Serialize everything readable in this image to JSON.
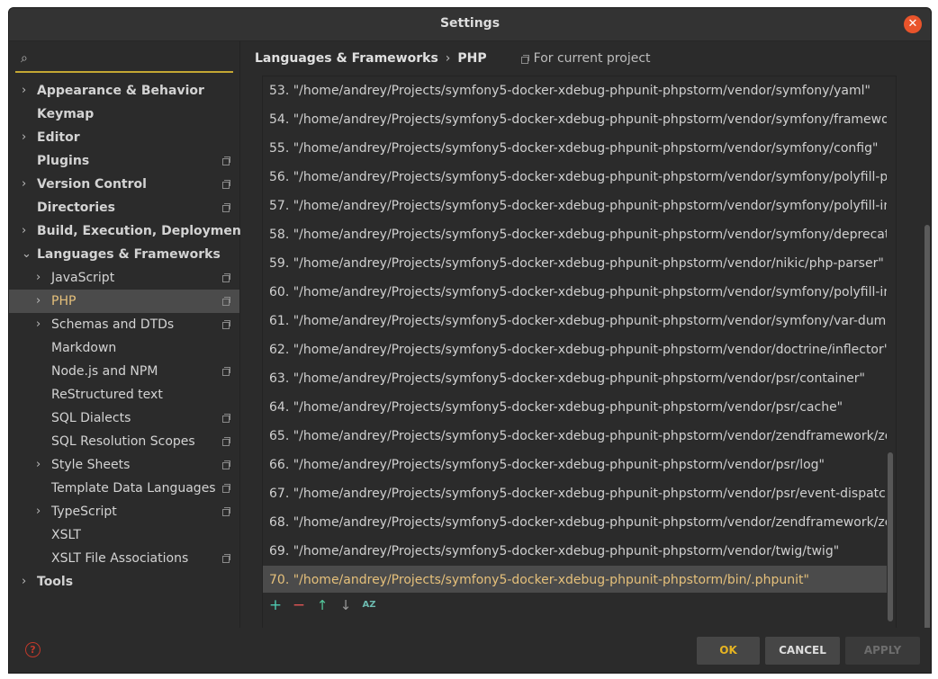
{
  "window": {
    "title": "Settings"
  },
  "search": {
    "value": ""
  },
  "sidebar": {
    "items": [
      {
        "label": "Appearance & Behavior",
        "level": 0,
        "expander": "›",
        "project": false,
        "selected": false
      },
      {
        "label": "Keymap",
        "level": 0,
        "expander": "",
        "project": false,
        "selected": false
      },
      {
        "label": "Editor",
        "level": 0,
        "expander": "›",
        "project": false,
        "selected": false
      },
      {
        "label": "Plugins",
        "level": 0,
        "expander": "",
        "project": true,
        "selected": false
      },
      {
        "label": "Version Control",
        "level": 0,
        "expander": "›",
        "project": true,
        "selected": false
      },
      {
        "label": "Directories",
        "level": 0,
        "expander": "",
        "project": true,
        "selected": false
      },
      {
        "label": "Build, Execution, Deployment",
        "level": 0,
        "expander": "›",
        "project": false,
        "selected": false
      },
      {
        "label": "Languages & Frameworks",
        "level": 0,
        "expander": "⌄",
        "project": false,
        "selected": false
      },
      {
        "label": "JavaScript",
        "level": 1,
        "expander": "›",
        "project": true,
        "selected": false
      },
      {
        "label": "PHP",
        "level": 1,
        "expander": "›",
        "project": true,
        "selected": true
      },
      {
        "label": "Schemas and DTDs",
        "level": 1,
        "expander": "›",
        "project": true,
        "selected": false
      },
      {
        "label": "Markdown",
        "level": 1,
        "expander": "",
        "project": false,
        "selected": false
      },
      {
        "label": "Node.js and NPM",
        "level": 1,
        "expander": "",
        "project": true,
        "selected": false
      },
      {
        "label": "ReStructured text",
        "level": 1,
        "expander": "",
        "project": false,
        "selected": false
      },
      {
        "label": "SQL Dialects",
        "level": 1,
        "expander": "",
        "project": true,
        "selected": false
      },
      {
        "label": "SQL Resolution Scopes",
        "level": 1,
        "expander": "",
        "project": true,
        "selected": false
      },
      {
        "label": "Style Sheets",
        "level": 1,
        "expander": "›",
        "project": true,
        "selected": false
      },
      {
        "label": "Template Data Languages",
        "level": 1,
        "expander": "",
        "project": true,
        "selected": false
      },
      {
        "label": "TypeScript",
        "level": 1,
        "expander": "›",
        "project": true,
        "selected": false
      },
      {
        "label": "XSLT",
        "level": 1,
        "expander": "",
        "project": false,
        "selected": false
      },
      {
        "label": "XSLT File Associations",
        "level": 1,
        "expander": "",
        "project": true,
        "selected": false
      },
      {
        "label": "Tools",
        "level": 0,
        "expander": "›",
        "project": false,
        "selected": false
      }
    ]
  },
  "breadcrumb": {
    "section": "Languages & Frameworks",
    "separator": "›",
    "page": "PHP",
    "scope": "For current project"
  },
  "include_paths": [
    {
      "text": "53. \"/home/andrey/Projects/symfony5-docker-xdebug-phpunit-phpstorm/vendor/symfony/yaml\"",
      "selected": false
    },
    {
      "text": "54. \"/home/andrey/Projects/symfony5-docker-xdebug-phpunit-phpstorm/vendor/symfony/framewo",
      "selected": false
    },
    {
      "text": "55. \"/home/andrey/Projects/symfony5-docker-xdebug-phpunit-phpstorm/vendor/symfony/config\"",
      "selected": false
    },
    {
      "text": "56. \"/home/andrey/Projects/symfony5-docker-xdebug-phpunit-phpstorm/vendor/symfony/polyfill-pl",
      "selected": false
    },
    {
      "text": "57. \"/home/andrey/Projects/symfony5-docker-xdebug-phpunit-phpstorm/vendor/symfony/polyfill-in",
      "selected": false
    },
    {
      "text": "58. \"/home/andrey/Projects/symfony5-docker-xdebug-phpunit-phpstorm/vendor/symfony/deprecat",
      "selected": false
    },
    {
      "text": "59. \"/home/andrey/Projects/symfony5-docker-xdebug-phpunit-phpstorm/vendor/nikic/php-parser\"",
      "selected": false
    },
    {
      "text": "60. \"/home/andrey/Projects/symfony5-docker-xdebug-phpunit-phpstorm/vendor/symfony/polyfill-in",
      "selected": false
    },
    {
      "text": "61. \"/home/andrey/Projects/symfony5-docker-xdebug-phpunit-phpstorm/vendor/symfony/var-dump",
      "selected": false
    },
    {
      "text": "62. \"/home/andrey/Projects/symfony5-docker-xdebug-phpunit-phpstorm/vendor/doctrine/inflector\"",
      "selected": false
    },
    {
      "text": "63. \"/home/andrey/Projects/symfony5-docker-xdebug-phpunit-phpstorm/vendor/psr/container\"",
      "selected": false
    },
    {
      "text": "64. \"/home/andrey/Projects/symfony5-docker-xdebug-phpunit-phpstorm/vendor/psr/cache\"",
      "selected": false
    },
    {
      "text": "65. \"/home/andrey/Projects/symfony5-docker-xdebug-phpunit-phpstorm/vendor/zendframework/ze",
      "selected": false
    },
    {
      "text": "66. \"/home/andrey/Projects/symfony5-docker-xdebug-phpunit-phpstorm/vendor/psr/log\"",
      "selected": false
    },
    {
      "text": "67. \"/home/andrey/Projects/symfony5-docker-xdebug-phpunit-phpstorm/vendor/psr/event-dispatch",
      "selected": false
    },
    {
      "text": "68. \"/home/andrey/Projects/symfony5-docker-xdebug-phpunit-phpstorm/vendor/zendframework/ze",
      "selected": false
    },
    {
      "text": "69. \"/home/andrey/Projects/symfony5-docker-xdebug-phpunit-phpstorm/vendor/twig/twig\"",
      "selected": false
    },
    {
      "text": "70. \"/home/andrey/Projects/symfony5-docker-xdebug-phpunit-phpstorm/bin/.phpunit\"",
      "selected": true
    }
  ],
  "list_toolbar": {
    "add": "+",
    "remove": "−",
    "up": "↑",
    "down": "↓",
    "sort": "AZ"
  },
  "icons": {
    "close": "✕",
    "search": "⌕",
    "help": "?"
  },
  "buttons": {
    "ok": "OK",
    "cancel": "CANCEL",
    "apply": "APPLY"
  },
  "colors": {
    "accent": "#e5c07b",
    "selection_bg": "#4b4b4b",
    "search_underline": "#c4a733",
    "close": "#e9542b"
  }
}
